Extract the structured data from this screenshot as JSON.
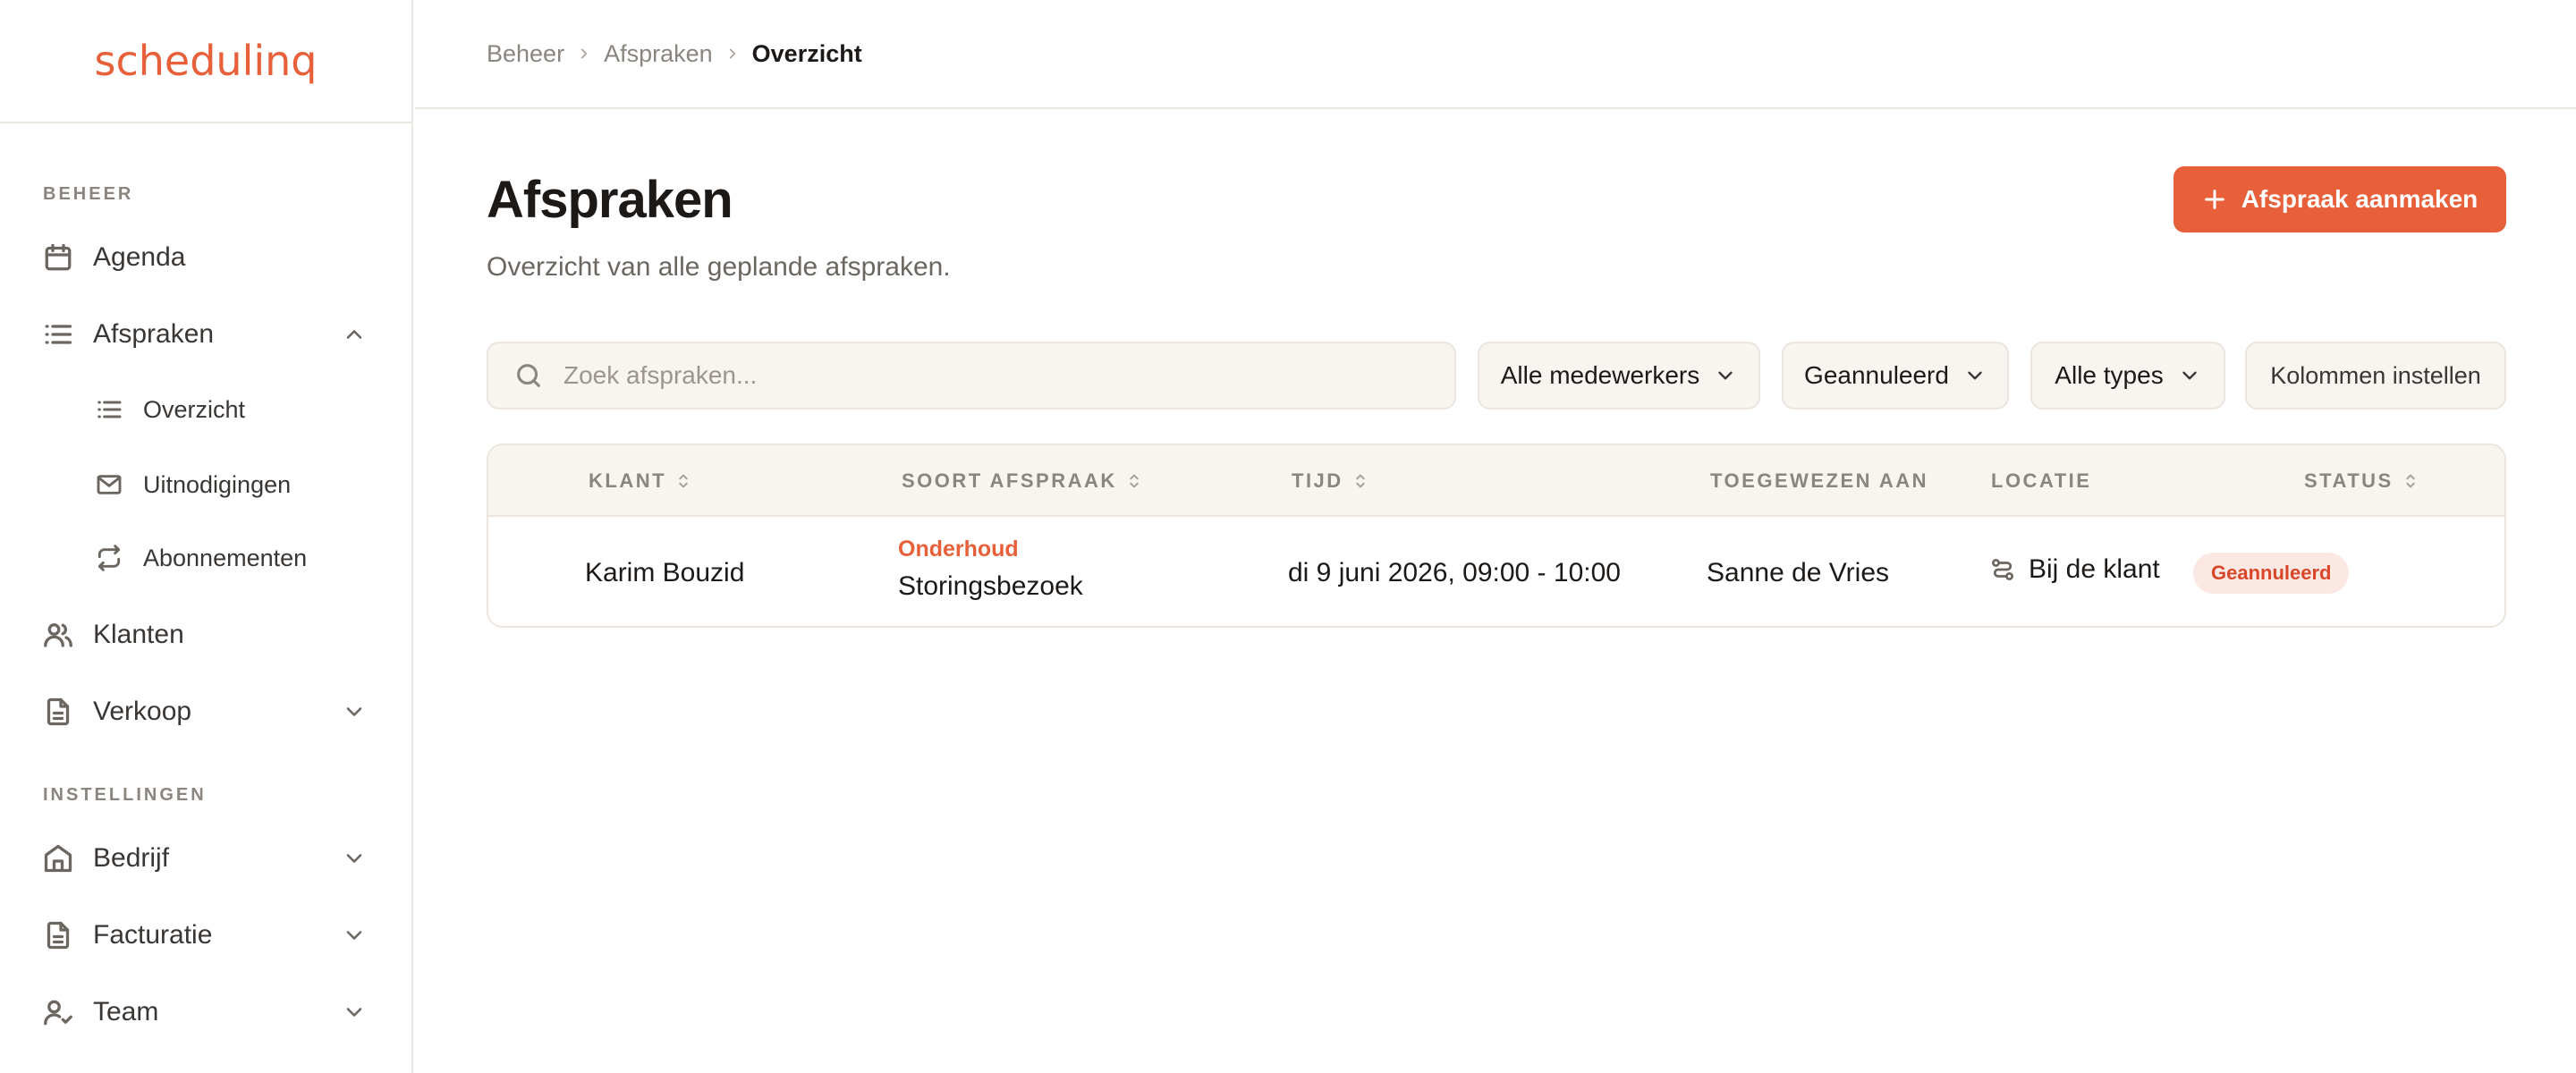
{
  "app": {
    "logo_text": "schedulinq",
    "accent_color": "#e8603a"
  },
  "sidebar": {
    "section_beheer": "BEHEER",
    "section_instellingen": "INSTELLINGEN",
    "items": [
      {
        "label": "Agenda",
        "icon": "calendar-icon"
      },
      {
        "label": "Afspraken",
        "icon": "list-icon",
        "expanded": true
      },
      {
        "label": "Klanten",
        "icon": "users-icon"
      },
      {
        "label": "Verkoop",
        "icon": "document-icon"
      },
      {
        "label": "Bedrijf",
        "icon": "building-icon"
      },
      {
        "label": "Facturatie",
        "icon": "document-icon"
      },
      {
        "label": "Team",
        "icon": "user-check-icon"
      }
    ],
    "subitems": [
      {
        "label": "Overzicht",
        "icon": "list-icon"
      },
      {
        "label": "Uitnodigingen",
        "icon": "mail-icon"
      },
      {
        "label": "Abonnementen",
        "icon": "repeat-icon"
      }
    ]
  },
  "breadcrumb": [
    "Beheer",
    "Afspraken",
    "Overzicht"
  ],
  "page": {
    "title": "Afspraken",
    "subtitle": "Overzicht van alle geplande afspraken.",
    "create_button": "Afspraak aanmaken"
  },
  "filters": {
    "search_placeholder": "Zoek afspraken...",
    "employees": "Alle medewerkers",
    "status": "Geannuleerd",
    "types": "Alle types",
    "columns": "Kolommen instellen"
  },
  "table": {
    "columns": [
      "KLANT",
      "SOORT AFSPRAAK",
      "TIJD",
      "TOEGEWEZEN AAN",
      "LOCATIE",
      "STATUS"
    ],
    "rows": [
      {
        "client": "Karim Bouzid",
        "type_category": "Onderhoud",
        "type_name": "Storingsbezoek",
        "time": "di 9 juni 2026, 09:00 - 10:00",
        "assigned": "Sanne de Vries",
        "location": "Bij de klant",
        "status": "Geannuleerd"
      }
    ]
  }
}
